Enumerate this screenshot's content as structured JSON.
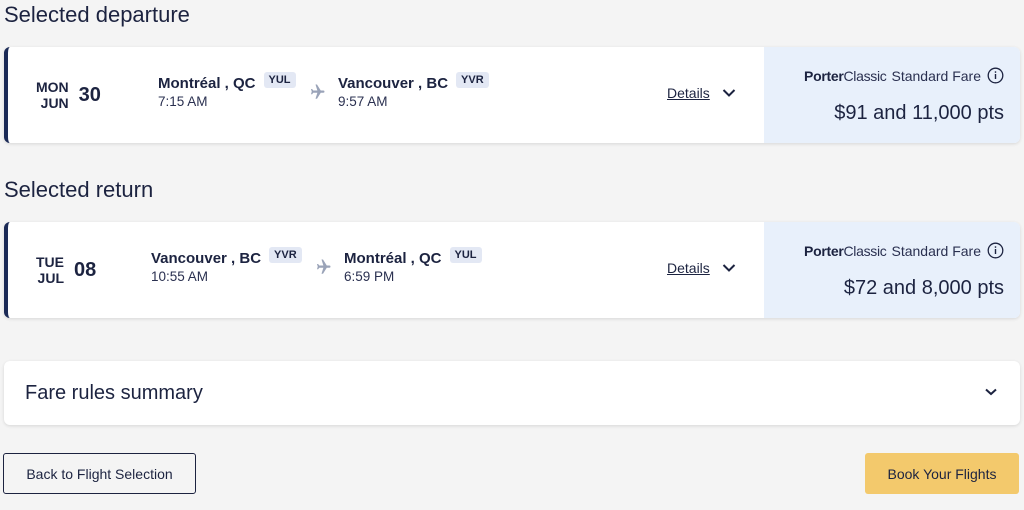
{
  "departure": {
    "section_title": "Selected departure",
    "weekday": "MON",
    "month": "JUN",
    "day": "30",
    "origin": {
      "city": "Montréal , QC",
      "code": "YUL",
      "time": "7:15 AM"
    },
    "destination": {
      "city": "Vancouver , BC",
      "code": "YVR",
      "time": "9:57 AM"
    },
    "details_label": "Details",
    "fare": {
      "brand_bold": "Porter",
      "brand_light": "Classic",
      "fare_name": "Standard Fare",
      "price": "$91 and 11,000 pts"
    }
  },
  "return": {
    "section_title": "Selected return",
    "weekday": "TUE",
    "month": "JUL",
    "day": "08",
    "origin": {
      "city": "Vancouver , BC",
      "code": "YVR",
      "time": "10:55 AM"
    },
    "destination": {
      "city": "Montréal , QC",
      "code": "YUL",
      "time": "6:59 PM"
    },
    "details_label": "Details",
    "fare": {
      "brand_bold": "Porter",
      "brand_light": "Classic",
      "fare_name": "Standard Fare",
      "price": "$72 and 8,000 pts"
    }
  },
  "fare_rules": {
    "title": "Fare rules summary"
  },
  "actions": {
    "back_label": "Back to Flight Selection",
    "book_label": "Book Your Flights"
  },
  "colors": {
    "accent_navy": "#1b2a56",
    "fare_panel_bg": "#e8f0fb",
    "book_button": "#f3c96c",
    "code_badge_bg": "#e3e8f4"
  },
  "icons": {
    "plane": "plane-icon",
    "chevron": "chevron-down-icon",
    "info": "info-icon"
  }
}
